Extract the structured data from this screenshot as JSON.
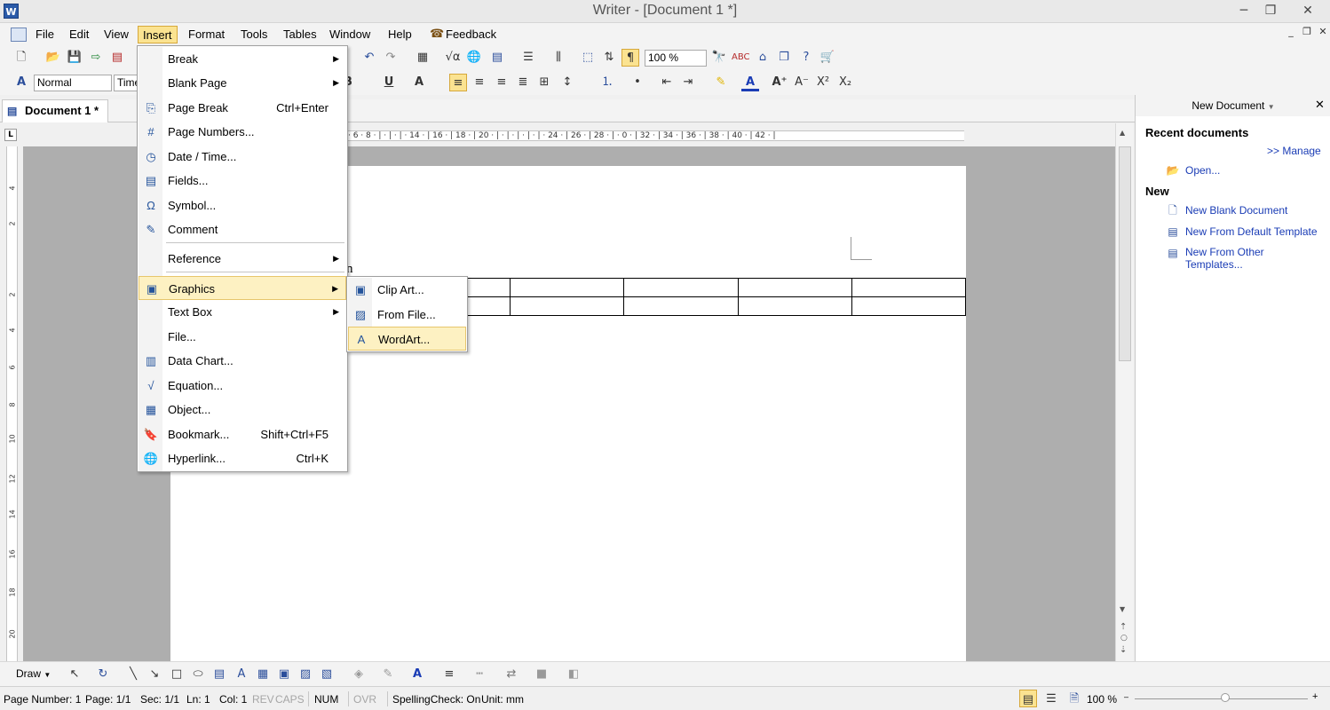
{
  "window": {
    "title": "Writer - [Document 1 *]",
    "app_icon": "W",
    "minimize": "─",
    "maximize": "❐",
    "close": "✕"
  },
  "menubar": {
    "items": [
      "File",
      "Edit",
      "View",
      "Insert",
      "Format",
      "Tools",
      "Tables",
      "Window",
      "Help",
      "Feedback"
    ],
    "mdi_min": "_",
    "mdi_restore": "❐",
    "mdi_close": "✕"
  },
  "toolbar": {
    "zoom": "100 %",
    "style": "Normal",
    "font": "Time"
  },
  "doc_tab": {
    "label": "Document 1 *"
  },
  "ruler": {
    "text": "· 6 · 8 · | · | · | · 14 · | 16 · | 18 · | 20 · | · | · | · | · | · 24 · | 26 · | 28 · | · 0 · | 32 · | 34 · | 36 · | 38 · | 40 · | 42 · |",
    "v_ticks": [
      "4",
      "2",
      "2",
      "4",
      "6",
      "8",
      "10",
      "12",
      "14",
      "16",
      "18",
      "20"
    ]
  },
  "document": {
    "fragment": "n"
  },
  "insert_menu": [
    {
      "label": "Break",
      "shortcut": "",
      "submenu": true,
      "icon": ""
    },
    {
      "label": "Blank Page",
      "shortcut": "",
      "submenu": true,
      "icon": ""
    },
    {
      "label": "Page Break",
      "shortcut": "Ctrl+Enter",
      "submenu": false,
      "icon": "⎘"
    },
    {
      "label": "Page Numbers...",
      "shortcut": "",
      "submenu": false,
      "icon": "#"
    },
    {
      "label": "Date / Time...",
      "shortcut": "",
      "submenu": false,
      "icon": "◷"
    },
    {
      "label": "Fields...",
      "shortcut": "",
      "submenu": false,
      "icon": "▤"
    },
    {
      "label": "Symbol...",
      "shortcut": "",
      "submenu": false,
      "icon": "Ω"
    },
    {
      "label": "Comment",
      "shortcut": "",
      "submenu": false,
      "icon": "✎"
    },
    {
      "label": "Reference",
      "shortcut": "",
      "submenu": true,
      "icon": ""
    },
    {
      "label": "Graphics",
      "shortcut": "",
      "submenu": true,
      "icon": "▣"
    },
    {
      "label": "Text Box",
      "shortcut": "",
      "submenu": true,
      "icon": ""
    },
    {
      "label": "File...",
      "shortcut": "",
      "submenu": false,
      "icon": ""
    },
    {
      "label": "Data Chart...",
      "shortcut": "",
      "submenu": false,
      "icon": "▥"
    },
    {
      "label": "Equation...",
      "shortcut": "",
      "submenu": false,
      "icon": "√"
    },
    {
      "label": "Object...",
      "shortcut": "",
      "submenu": false,
      "icon": "▦"
    },
    {
      "label": "Bookmark...",
      "shortcut": "Shift+Ctrl+F5",
      "submenu": false,
      "icon": "🔖"
    },
    {
      "label": "Hyperlink...",
      "shortcut": "Ctrl+K",
      "submenu": false,
      "icon": "🌐"
    }
  ],
  "graphics_submenu": [
    {
      "label": "Clip Art...",
      "icon": "▣"
    },
    {
      "label": "From File...",
      "icon": "▨"
    },
    {
      "label": "WordArt...",
      "icon": "A"
    }
  ],
  "taskpane": {
    "title": "New Document",
    "close": "✕",
    "recent_heading": "Recent documents",
    "manage": ">> Manage",
    "open": "Open...",
    "new_heading": "New",
    "new_blank": "New Blank Document",
    "new_default": "New From Default Template",
    "new_other_1": "New From Other",
    "new_other_2": "Templates..."
  },
  "drawbar": {
    "draw": "Draw"
  },
  "status": {
    "page_number": "Page Number: 1",
    "page": "Page: 1/1",
    "sec": "Sec: 1/1",
    "ln": "Ln: 1",
    "col": "Col: 1",
    "rev": "REV",
    "caps": "CAPS",
    "num": "NUM",
    "ovr": "OVR",
    "spelling": "SpellingCheck: On",
    "unit": "Unit: mm",
    "zoom": "100 %"
  }
}
